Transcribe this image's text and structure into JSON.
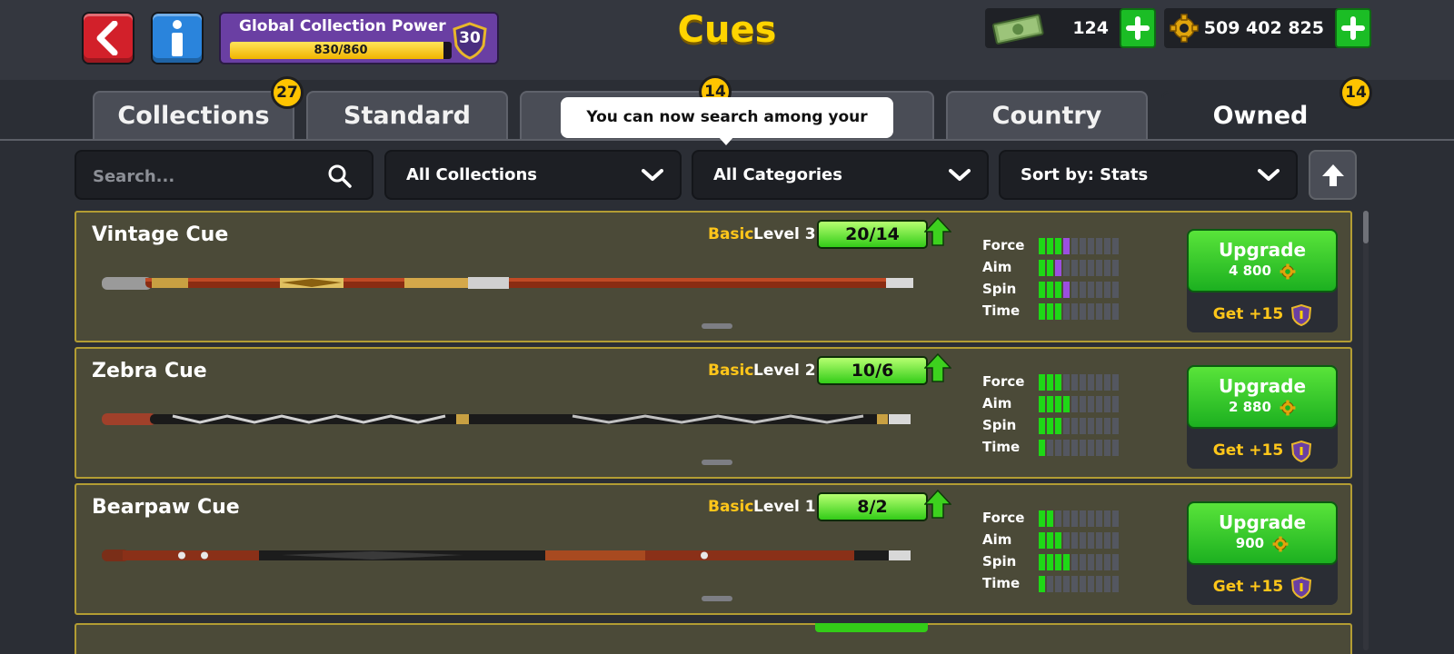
{
  "header": {
    "title": "Cues",
    "back_icon": "back-arrow-icon",
    "info_icon": "info-icon"
  },
  "global_collection_power": {
    "label": "Global Collection Power",
    "progress_text": "830/860",
    "progress_fraction": 0.965,
    "level": "30"
  },
  "currency": {
    "cash": "124",
    "coins": "509 402 825"
  },
  "tabs": [
    {
      "label": "Collections",
      "badge": "27",
      "active": false
    },
    {
      "label": "Standard",
      "badge": "",
      "active": false
    },
    {
      "label": "",
      "badge": "14",
      "active": false
    },
    {
      "label": "Country",
      "badge": "",
      "active": false
    },
    {
      "label": "Owned",
      "badge": "14",
      "active": true
    }
  ],
  "tooltip": "You can now search among your cues!",
  "filters": {
    "search_placeholder": "Search...",
    "collections": "All Collections",
    "categories": "All Categories",
    "sort": "Sort by: Stats"
  },
  "stat_labels": [
    "Force",
    "Aim",
    "Spin",
    "Time"
  ],
  "cues": [
    {
      "name": "Vintage Cue",
      "rarity": "Basic",
      "level": "Level 3",
      "progress": "20/14",
      "stats": [
        [
          3,
          1
        ],
        [
          2,
          1
        ],
        [
          3,
          1
        ],
        [
          3,
          0
        ]
      ],
      "upgrade_label": "Upgrade",
      "upgrade_cost": "4 800",
      "get_label": "Get +15"
    },
    {
      "name": "Zebra Cue",
      "rarity": "Basic",
      "level": "Level 2",
      "progress": "10/6",
      "stats": [
        [
          3,
          0
        ],
        [
          4,
          0
        ],
        [
          3,
          0
        ],
        [
          1,
          0
        ]
      ],
      "upgrade_label": "Upgrade",
      "upgrade_cost": "2 880",
      "get_label": "Get +15"
    },
    {
      "name": "Bearpaw Cue",
      "rarity": "Basic",
      "level": "Level 1",
      "progress": "8/2",
      "stats": [
        [
          2,
          0
        ],
        [
          3,
          0
        ],
        [
          4,
          0
        ],
        [
          1,
          0
        ]
      ],
      "upgrade_label": "Upgrade",
      "upgrade_cost": "900",
      "get_label": "Get +15"
    }
  ],
  "colors": {
    "stat_filled": "#1ed816",
    "stat_bonus": "#9b4fe0",
    "stat_empty": "#545760",
    "accent_gold": "#ffd400",
    "upgrade_green": "#1cb020"
  }
}
